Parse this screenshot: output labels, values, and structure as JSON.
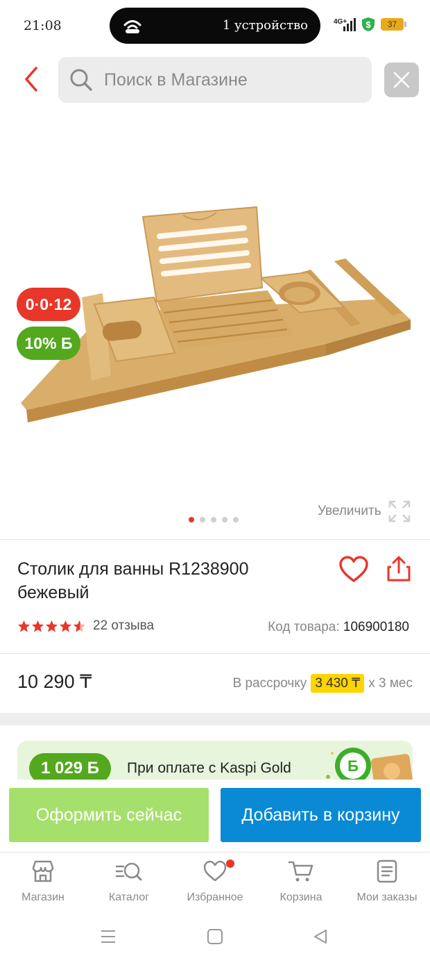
{
  "status_bar": {
    "time": "21:08",
    "island_text": "1 устройство",
    "network": "4G+",
    "battery": "37"
  },
  "header": {
    "search_placeholder": "Поиск в Магазине"
  },
  "gallery": {
    "installment_badge": "0·0·12",
    "bonus_badge": "10% Б",
    "zoom_label": "Увеличить",
    "slides_total": 5,
    "active_slide": 1
  },
  "product": {
    "title": "Столик для ванны R1238900 бежевый",
    "rating": 4.5,
    "reviews_label": "22 отзыва",
    "sku_label": "Код товара:",
    "sku_value": "106900180",
    "price": "10 290 ₸",
    "installment_prefix": "В рассрочку",
    "installment_amount": "3 430 ₸",
    "installment_suffix": "x 3 мес"
  },
  "promo": {
    "bonus_amount": "1 029 Б",
    "text": "При оплате с Kaspi Gold"
  },
  "actions": {
    "buy_now": "Оформить сейчас",
    "add_to_cart": "Добавить в корзину"
  },
  "bottom_nav": {
    "items": [
      {
        "label": "Магазин",
        "icon": "store-icon"
      },
      {
        "label": "Каталог",
        "icon": "catalog-search-icon"
      },
      {
        "label": "Избранное",
        "icon": "heart-icon"
      },
      {
        "label": "Корзина",
        "icon": "cart-icon"
      },
      {
        "label": "Мои заказы",
        "icon": "orders-icon"
      }
    ]
  },
  "colors": {
    "accent_red": "#e8372a",
    "bonus_green": "#53a81d",
    "buy_now_green": "#a5e06c",
    "cart_blue": "#0a8ad4",
    "installment_yellow": "#ffd400"
  }
}
